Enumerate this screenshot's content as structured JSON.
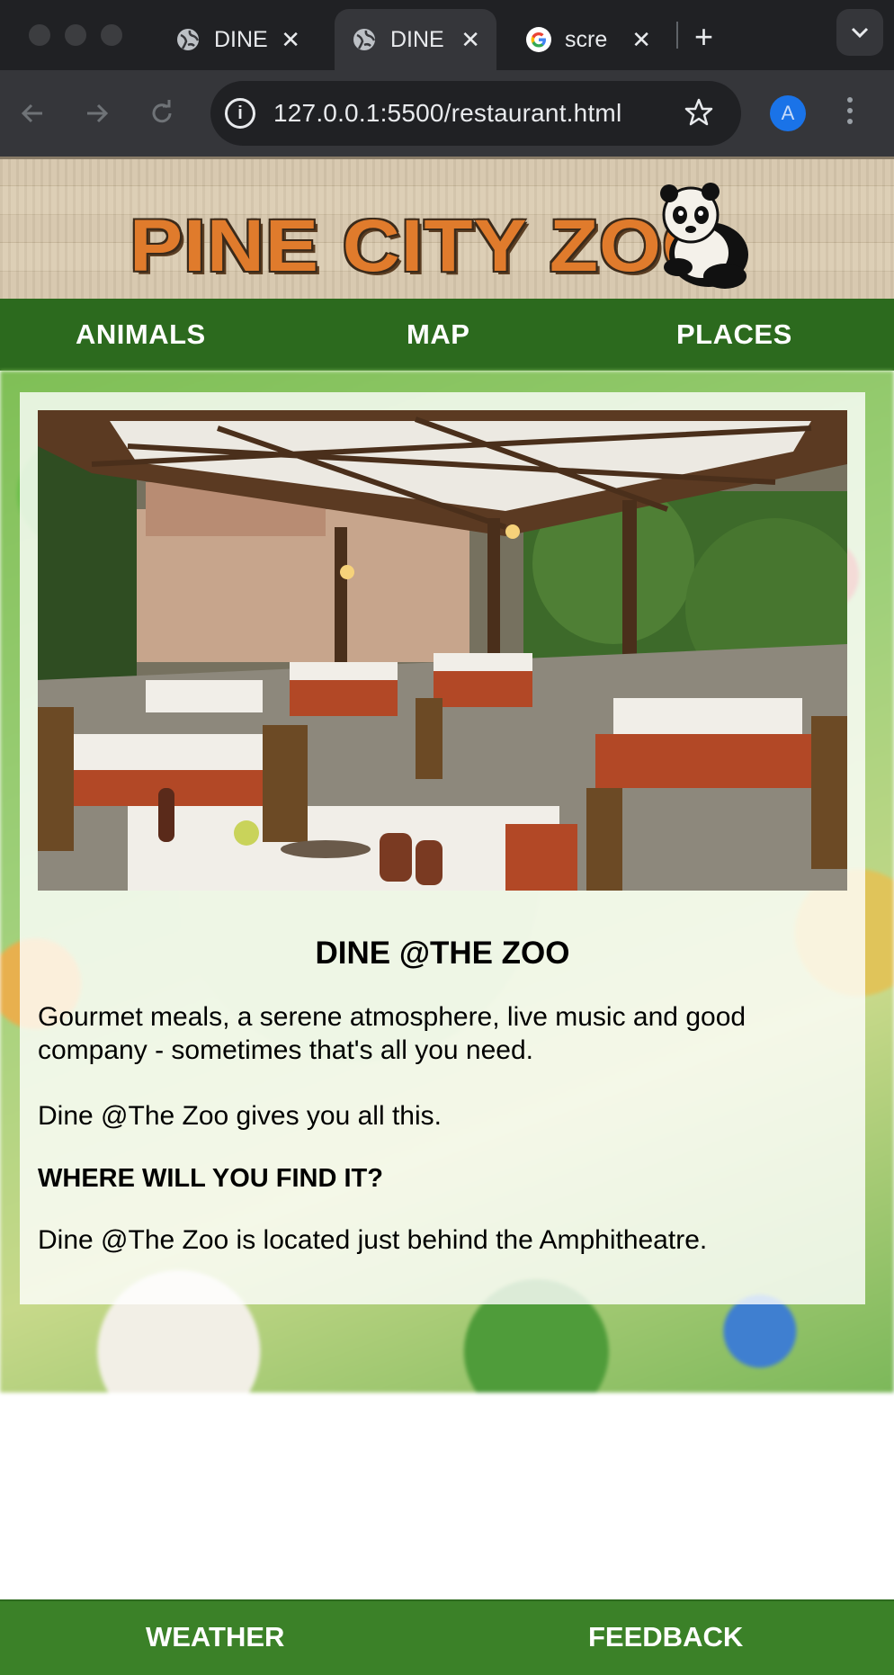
{
  "browser": {
    "tabs": [
      {
        "title": "DINE",
        "icon": "globe-icon",
        "active": false
      },
      {
        "title": "DINE",
        "icon": "globe-icon",
        "active": true
      },
      {
        "title": "scre",
        "icon": "google-icon",
        "active": false
      }
    ],
    "new_tab": "+",
    "url": "127.0.0.1:5500/restaurant.html",
    "profile_initial": "A"
  },
  "site": {
    "logo": "PINE CITY ZOO",
    "nav": [
      "ANIMALS",
      "MAP",
      "PLACES"
    ],
    "footer_nav": [
      "WEATHER",
      "FEEDBACK"
    ]
  },
  "content": {
    "heading": "DINE @THE ZOO",
    "intro": "Gourmet meals, a serene atmosphere, live music and good company - sometimes that's all you need.",
    "tagline": "Dine @The Zoo gives you all this.",
    "subheading": "WHERE WILL YOU FIND IT?",
    "location": "Dine @The Zoo is located just behind the Amphitheatre.",
    "hero_image": "restaurant-patio-photo"
  },
  "colors": {
    "nav_green": "#2c6a1e",
    "footer_green": "#3b8128",
    "logo_orange": "#e07b2c"
  }
}
